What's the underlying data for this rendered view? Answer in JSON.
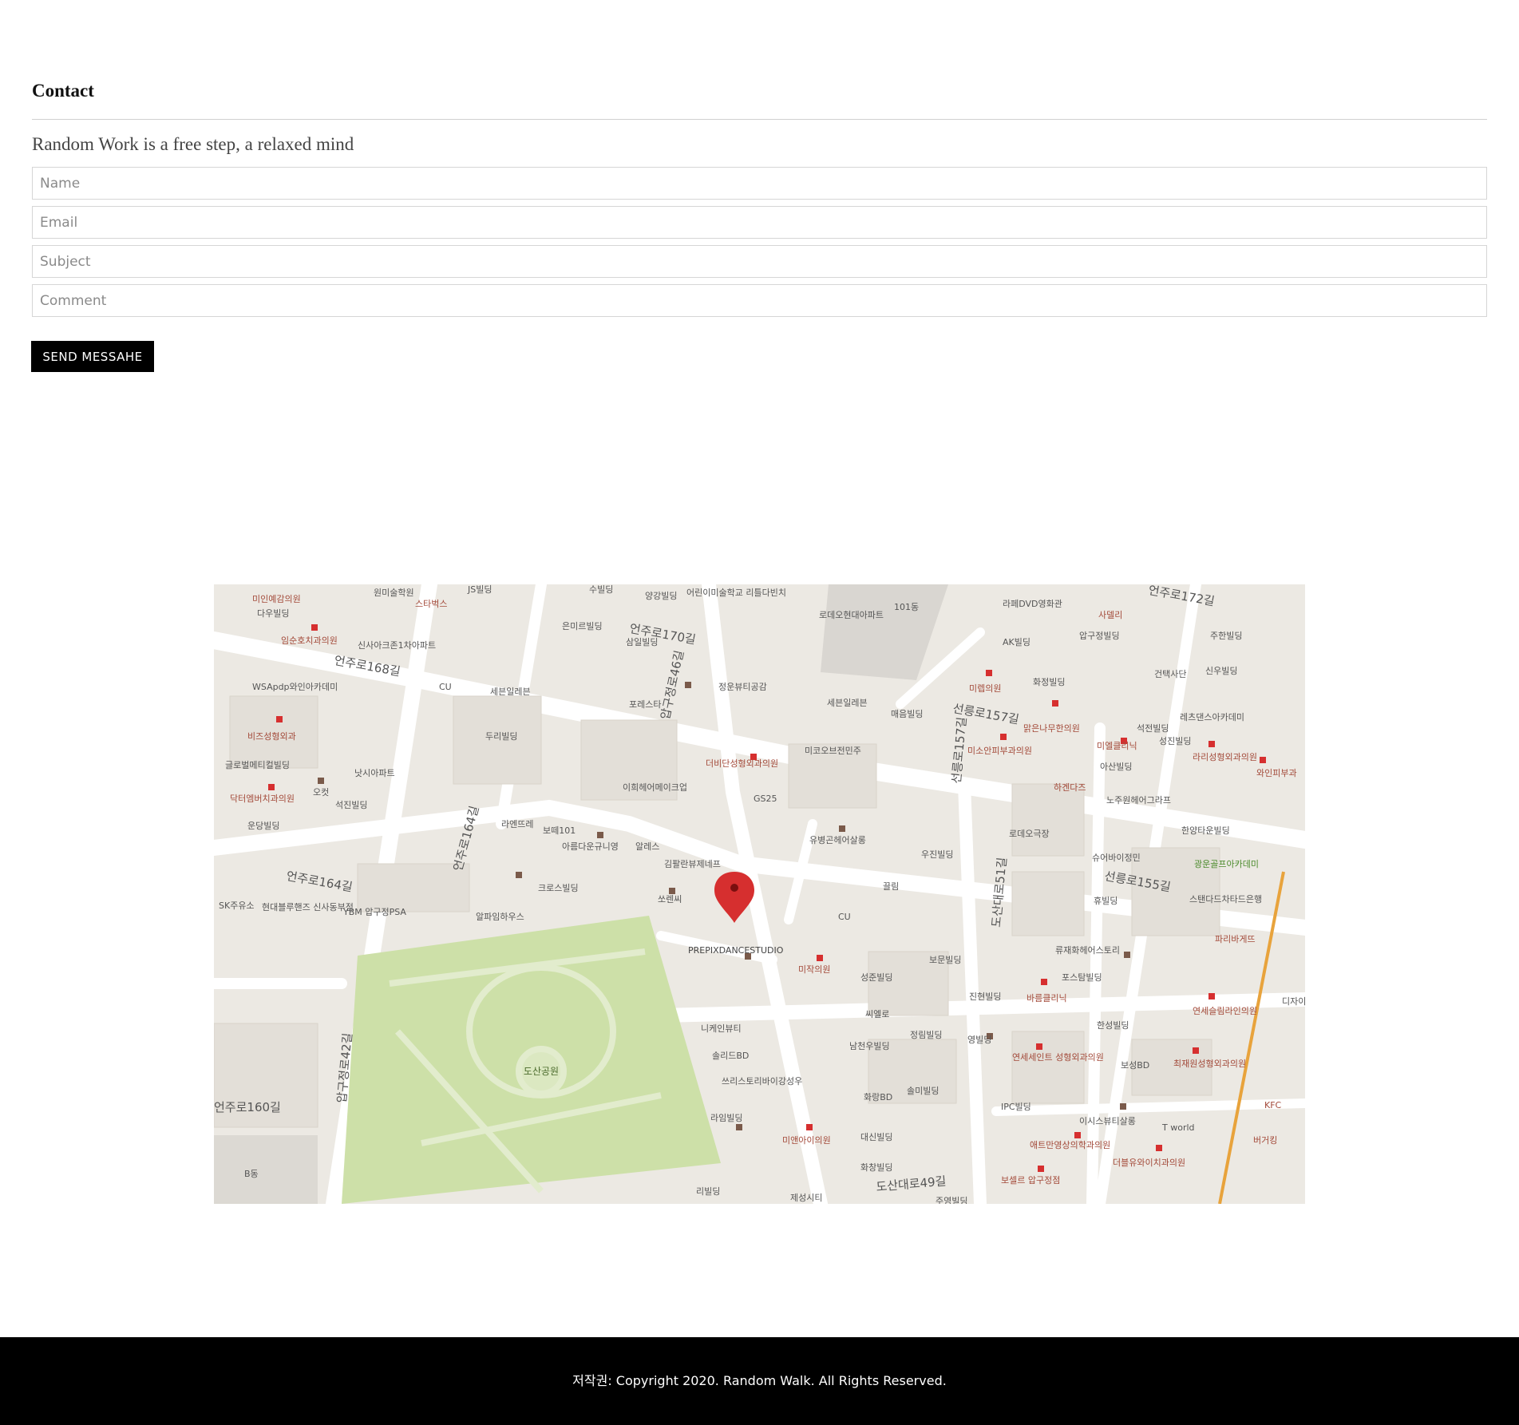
{
  "contact": {
    "title": "Contact",
    "tagline": "Random Work is a free step, a relaxed mind",
    "fields": {
      "name_placeholder": "Name",
      "email_placeholder": "Email",
      "subject_placeholder": "Subject",
      "comment_placeholder": "Comment"
    },
    "send_label": "SEND MESSAHE"
  },
  "map": {
    "park_label": "도산공원",
    "marker_label": "PREPIXDANCESTUDIO",
    "road_labels": [
      "언주로170길",
      "언주로168길",
      "언주로164길",
      "언주로160길",
      "선릉로157길",
      "선릉로155길",
      "도산대로49길",
      "압구정로46길",
      "압구정로42길",
      "언주로164길",
      "도산대로51길",
      "선릉로157길",
      "언주로172길"
    ],
    "place_labels": [
      "미인예감의원",
      "다우빌딩",
      "원미술학원",
      "스타벅스",
      "JS빌딩",
      "수빌딩",
      "양강빌딩",
      "어린이미술학교 리틀다빈치",
      "로데오현대아파트",
      "101동",
      "라페DVD영화관",
      "사델리",
      "은미르빌딩",
      "임순호치과의원",
      "신사아크존1차아파트",
      "삼일빌딩",
      "AK빌딩",
      "압구정빌딩",
      "주한빌딩",
      "WSApdp와인아카데미",
      "CU",
      "세븐일레븐",
      "포레스타",
      "정운뷰티공감",
      "세븐일레븐",
      "매음빌딩",
      "미렙의원",
      "화정빌딩",
      "건택사단",
      "신우빌딩",
      "비즈성형외과",
      "두리빌딩",
      "더비단성형외과의원",
      "미코오브전민주",
      "맑은나무한의원",
      "석전빌딩",
      "레츠댄스아카데미",
      "글로벌메티컬빌딩",
      "낫시아파트",
      "오컷",
      "이희헤어메이크업",
      "GS25",
      "미소안피부과의원",
      "미엘클리닉",
      "성진빌딩",
      "닥터엠버치과의원",
      "석진빌딩",
      "라엔뜨레",
      "보떼101",
      "하겐다즈",
      "아산빌딩",
      "노주원헤어그라프",
      "라리성형외과의원",
      "와인피부과",
      "운당빌딩",
      "아름다운규니영",
      "알레스",
      "유병곤헤어살롱",
      "로데오극장",
      "한양타운빌딩",
      "김팔란뷰제네프",
      "우진빌딩",
      "슈어바이정민",
      "광운골프아카데미",
      "SK주유소",
      "현대블루핸즈 신사동부점",
      "YBM 압구정PSA",
      "크로스빌딩",
      "쏘렌씨",
      "끌림",
      "알파임하우스",
      "CU",
      "휴빌딩",
      "스탠다드차타드은행",
      "파리바게뜨",
      "미작의원",
      "보문빌딩",
      "류재화헤어스토리",
      "성준빌딩",
      "포스탐빌딩",
      "니케인뷰티",
      "씨엘로",
      "진현빌딩",
      "바름클리닉",
      "연세슬림라인의원",
      "솔리드BD",
      "남천우빌딩",
      "정림빌딩",
      "영빌딩",
      "한성빌딩",
      "연세세인트 성형외과의원",
      "보성BD",
      "최재원성형외과의원",
      "쓰리스토리바이강성우",
      "화랑BD",
      "솔미빌딩",
      "IPC빌딩",
      "이시스뷰티살롱",
      "T world",
      "KFC",
      "라임빌딩",
      "미앤아이의원",
      "대신빌딩",
      "애트만영상의학과의원",
      "버거킹",
      "B동",
      "화창빌딩",
      "더블유와이치과의원",
      "리빌딩",
      "제성시티",
      "주영빌딩",
      "보셀르 압구정점",
      "디자이"
    ]
  },
  "footer": {
    "copyright": "저작권: Copyright 2020. Random Walk. All Rights Reserved."
  },
  "colors": {
    "button_bg": "#000000",
    "footer_bg": "#000000",
    "map_bg": "#ece9e3",
    "park_green": "#cde0a8",
    "marker_red": "#d62f2f"
  }
}
